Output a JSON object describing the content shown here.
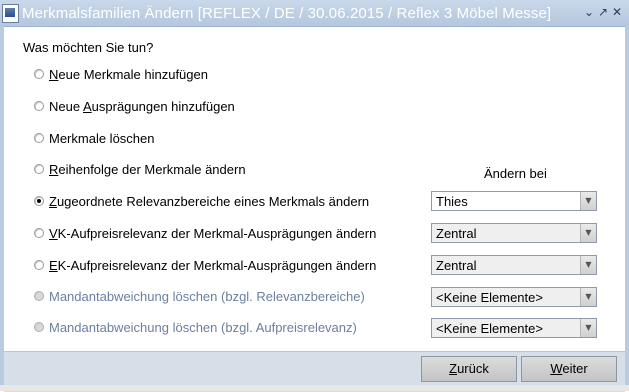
{
  "window": {
    "title": "Merkmalsfamilien Ändern    [REFLEX / DE / 30.06.2015 / Reflex 3 Möbel Messe]",
    "icon": "app-icon"
  },
  "question": "Was möchten Sie tun?",
  "column_header": "Ändern bei",
  "options": [
    {
      "pre": "",
      "ul": "N",
      "post": "eue Merkmale hinzufügen",
      "checked": false,
      "enabled": true
    },
    {
      "pre": "Neue ",
      "ul": "A",
      "post": "usprägungen hinzufügen",
      "checked": false,
      "enabled": true
    },
    {
      "pre": "",
      "ul": "",
      "post": "Merkmale löschen",
      "checked": false,
      "enabled": true
    },
    {
      "pre": "",
      "ul": "R",
      "post": "eihenfolge der Merkmale ändern",
      "checked": false,
      "enabled": true
    },
    {
      "pre": "",
      "ul": "Z",
      "post": "ugeordnete Relevanzbereiche eines Merkmals ändern",
      "checked": true,
      "enabled": true
    },
    {
      "pre": "",
      "ul": "V",
      "post": "K-Aufpreisrelevanz der Merkmal-Ausprägungen ändern",
      "checked": false,
      "enabled": true
    },
    {
      "pre": "",
      "ul": "E",
      "post": "K-Aufpreisrelevanz der Merkmal-Ausprägungen ändern",
      "checked": false,
      "enabled": true
    },
    {
      "pre": "",
      "ul": "",
      "post": "Mandantabweichung löschen (bzgl. Relevanzbereiche)",
      "checked": false,
      "enabled": false
    },
    {
      "pre": "",
      "ul": "",
      "post": "Mandantabweichung löschen (bzgl. Aufpreisrelevanz)",
      "checked": false,
      "enabled": false
    }
  ],
  "selects": [
    {
      "value": "Thies"
    },
    {
      "value": "Zentral"
    },
    {
      "value": "Zentral"
    },
    {
      "value": "<Keine Elemente>"
    },
    {
      "value": "<Keine Elemente>"
    }
  ],
  "buttons": {
    "back": {
      "ul": "Z",
      "rest": "urück"
    },
    "next": {
      "ul": "W",
      "rest": "eiter"
    }
  },
  "colors": {
    "titlebar": "#b4c7de",
    "footer": "#d6dee8",
    "disabled_text": "#6b7fa0"
  }
}
